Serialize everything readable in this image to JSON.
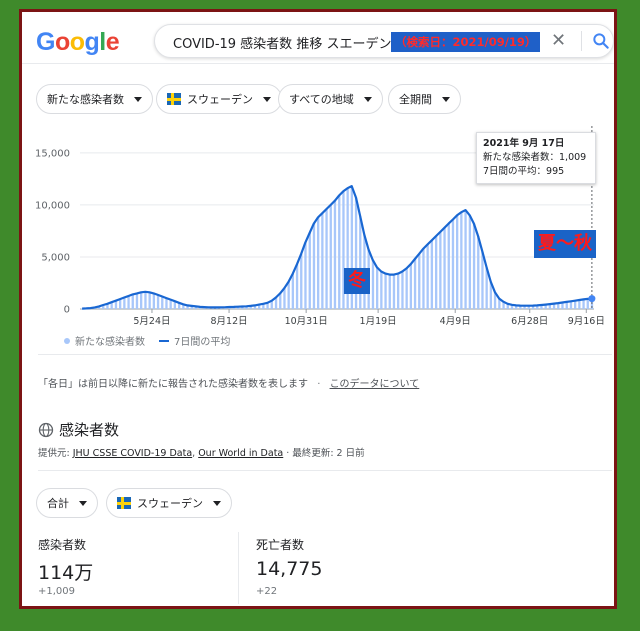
{
  "search": {
    "query": "COVID-19  感染者数  推移  スエーデン",
    "highlight": "（検索日：2021/09/19）"
  },
  "filters": [
    {
      "label": "新たな感染者数"
    },
    {
      "label": "スウェーデン",
      "flag": true
    },
    {
      "label": "すべての地域"
    },
    {
      "label": "全期間"
    }
  ],
  "chart_data": {
    "type": "bar",
    "title": "",
    "xlabel": "",
    "ylabel": "",
    "ylim": [
      0,
      17000
    ],
    "y_ticks": [
      "15,000",
      "10,000",
      "5,000",
      "0"
    ],
    "x_ticks": [
      "5月24日",
      "8月12日",
      "10月31日",
      "1月19日",
      "4月9日",
      "6月28日",
      "9月16日"
    ],
    "series": [
      {
        "name": "新たな感染者数",
        "color": "#a8c7fa",
        "values": [
          40,
          60,
          90,
          150,
          250,
          380,
          500,
          650,
          800,
          950,
          1100,
          1250,
          1400,
          1500,
          1600,
          1650,
          1600,
          1500,
          1350,
          1200,
          1050,
          900,
          750,
          600,
          450,
          350,
          300,
          250,
          200,
          180,
          160,
          150,
          150,
          160,
          170,
          190,
          200,
          220,
          240,
          260,
          300,
          350,
          420,
          500,
          600,
          800,
          1100,
          1500,
          2000,
          2600,
          3400,
          4300,
          5300,
          6400,
          7300,
          8200,
          8800,
          9200,
          9600,
          10000,
          10400,
          10900,
          11300,
          11600,
          11800,
          10700,
          8900,
          7100,
          5700,
          4700,
          4000,
          3600,
          3400,
          3300,
          3300,
          3400,
          3600,
          3900,
          4300,
          4800,
          5300,
          5800,
          6200,
          6600,
          7000,
          7400,
          7800,
          8200,
          8600,
          9000,
          9300,
          9500,
          9000,
          8200,
          7000,
          5500,
          4000,
          2600,
          1600,
          1000,
          700,
          500,
          400,
          350,
          330,
          320,
          320,
          330,
          350,
          380,
          420,
          470,
          520,
          570,
          620,
          680,
          740,
          800,
          860,
          920,
          970,
          1009
        ]
      },
      {
        "name": "7日間の平均",
        "color": "#1967d2",
        "values": [
          40,
          60,
          90,
          150,
          250,
          380,
          500,
          650,
          800,
          950,
          1100,
          1250,
          1400,
          1500,
          1600,
          1650,
          1600,
          1500,
          1350,
          1200,
          1050,
          900,
          750,
          600,
          450,
          350,
          300,
          250,
          200,
          180,
          160,
          150,
          150,
          160,
          170,
          190,
          200,
          220,
          240,
          260,
          300,
          350,
          420,
          500,
          600,
          800,
          1100,
          1500,
          2000,
          2600,
          3400,
          4300,
          5300,
          6400,
          7300,
          8200,
          8800,
          9200,
          9600,
          10000,
          10400,
          10900,
          11300,
          11600,
          11800,
          10700,
          8900,
          7100,
          5700,
          4700,
          4000,
          3600,
          3400,
          3300,
          3300,
          3400,
          3600,
          3900,
          4300,
          4800,
          5300,
          5800,
          6200,
          6600,
          7000,
          7400,
          7800,
          8200,
          8600,
          9000,
          9300,
          9500,
          9000,
          8200,
          7000,
          5500,
          4000,
          2600,
          1600,
          1000,
          700,
          500,
          400,
          350,
          330,
          320,
          320,
          330,
          350,
          380,
          420,
          470,
          520,
          570,
          620,
          680,
          740,
          800,
          860,
          920,
          970,
          995
        ]
      }
    ]
  },
  "tooltip": {
    "date": "2021年 9月 17日",
    "new_cases": "新たな感染者数：1,009",
    "avg7": "7日間の平均：995"
  },
  "annotations": {
    "winter": "冬",
    "summer_autumn": "夏～秋"
  },
  "legend": {
    "bars": "新たな感染者数",
    "line": "7日間の平均"
  },
  "note": {
    "text": "「各日」は前日以降に新たに報告された感染者数を表します",
    "link": "このデータについて"
  },
  "section": {
    "title": "感染者数",
    "source_prefix": "提供元:",
    "source1": "JHU CSSE COVID-19 Data",
    "source2": "Our World in Data",
    "updated": "最終更新: 2 日前"
  },
  "stats_filters": [
    {
      "label": "合計"
    },
    {
      "label": "スウェーデン",
      "flag": true
    }
  ],
  "stats": [
    {
      "label": "感染者数",
      "value": "114万",
      "delta": "+1,009"
    },
    {
      "label": "死亡者数",
      "value": "14,775",
      "delta": "+22"
    }
  ],
  "colors": {
    "accent": "#1967d2",
    "bar": "#a8c7fa",
    "annotation_bg": "#1a63c7",
    "annotation_text": "#ff1a1a"
  }
}
